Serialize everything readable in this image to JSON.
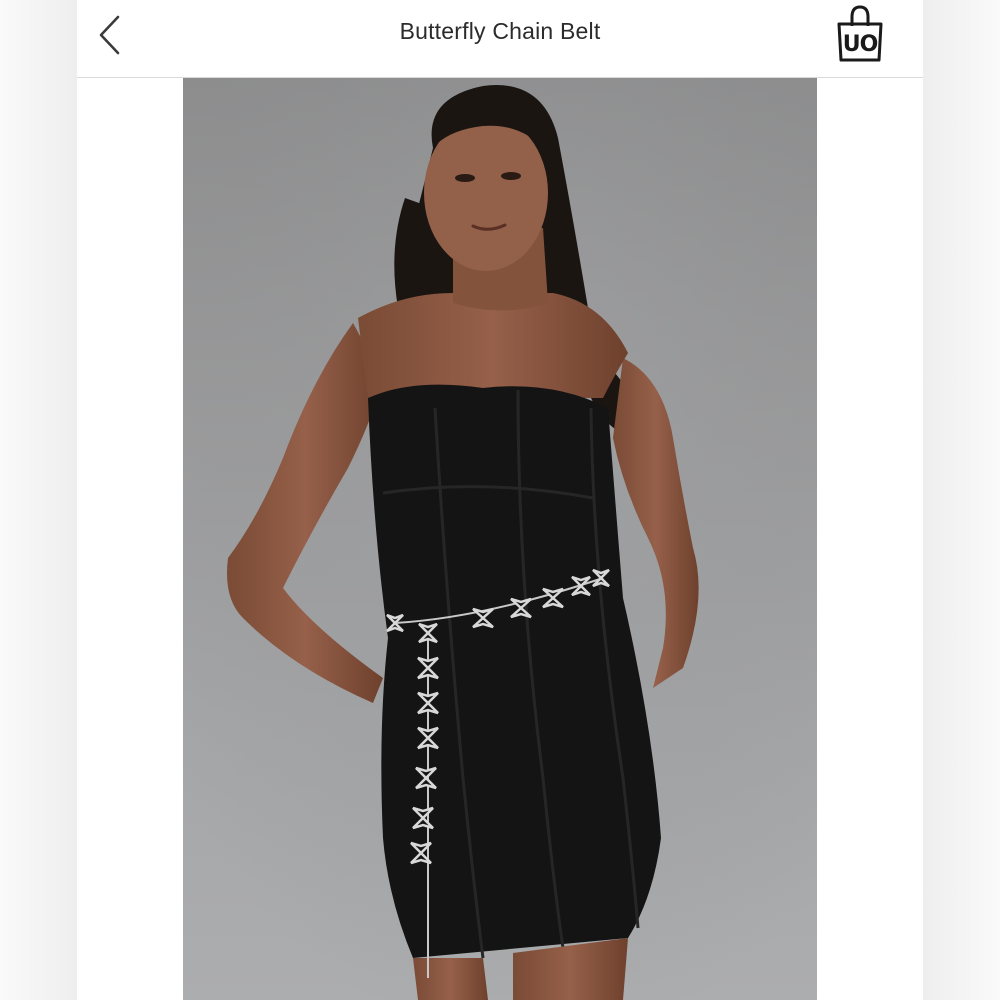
{
  "header": {
    "title": "Butterfly Chain Belt",
    "back_icon": "chevron-left-icon",
    "bag_icon": "shopping-bag-icon",
    "bag_logo": "UO"
  },
  "product_image": {
    "subject": "Model wearing black strapless dress with butterfly chain belt"
  },
  "colors": {
    "background": "#ffffff",
    "title_text": "#2b2b2b",
    "divider": "#d9d9d9",
    "photo_backdrop": "#9a9a9b",
    "dress": "#141414"
  }
}
